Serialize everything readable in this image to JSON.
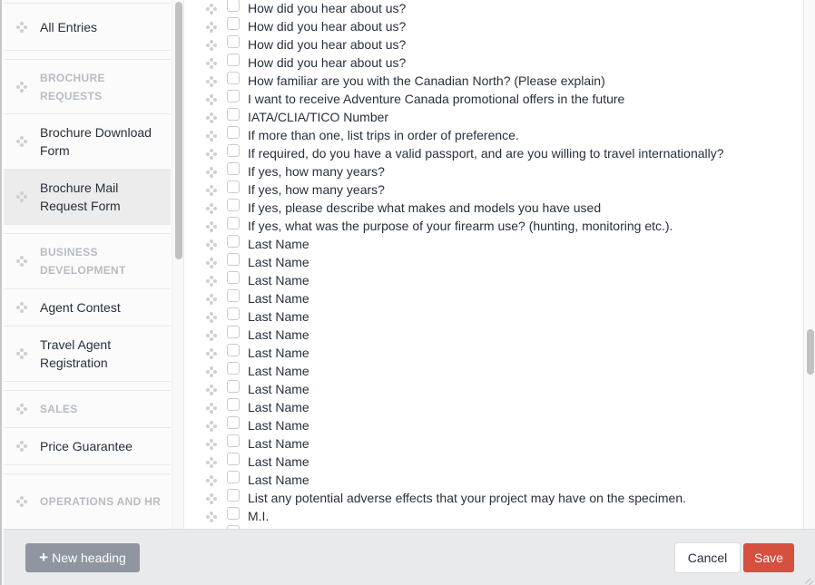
{
  "sidebar": {
    "items": [
      {
        "label": "All Entries",
        "type": "entry"
      },
      {
        "label": "BROCHURE REQUESTS",
        "type": "heading"
      },
      {
        "label": "Brochure Download Form",
        "type": "entry"
      },
      {
        "label": "Brochure Mail Request Form",
        "type": "entry",
        "selected": true
      },
      {
        "label": "BUSINESS DEVELOPMENT",
        "type": "heading"
      },
      {
        "label": "Agent Contest",
        "type": "entry"
      },
      {
        "label": "Travel Agent Registration",
        "type": "entry"
      },
      {
        "label": "SALES",
        "type": "heading"
      },
      {
        "label": "Price Guarantee",
        "type": "entry"
      },
      {
        "label": "OPERATIONS AND HR",
        "type": "heading"
      }
    ]
  },
  "fields": [
    "How did you hear about us?",
    "How did you hear about us?",
    "How did you hear about us?",
    "How did you hear about us?",
    "How familiar are you with the Canadian North? (Please explain)",
    "I want to receive Adventure Canada promotional offers in the future",
    "IATA/CLIA/TICO Number",
    "If more than one, list trips in order of preference.",
    "If required, do you have a valid passport, and are you willing to travel internationally?",
    "If yes, how many years?",
    "If yes, how many years?",
    "If yes, please describe what makes and models you have used",
    "If yes, what was the purpose of your firearm use? (hunting, monitoring etc.).",
    "Last Name",
    "Last Name",
    "Last Name",
    "Last Name",
    "Last Name",
    "Last Name",
    "Last Name",
    "Last Name",
    "Last Name",
    "Last Name",
    "Last Name",
    "Last Name",
    "Last Name",
    "Last Name",
    "List any potential adverse effects that your project may have on the specimen.",
    "M.I.",
    ""
  ],
  "footer": {
    "new_heading_label": "New heading",
    "cancel_label": "Cancel",
    "save_label": "Save"
  },
  "colors": {
    "save": "#d5503e",
    "new_heading": "#8f969f"
  }
}
